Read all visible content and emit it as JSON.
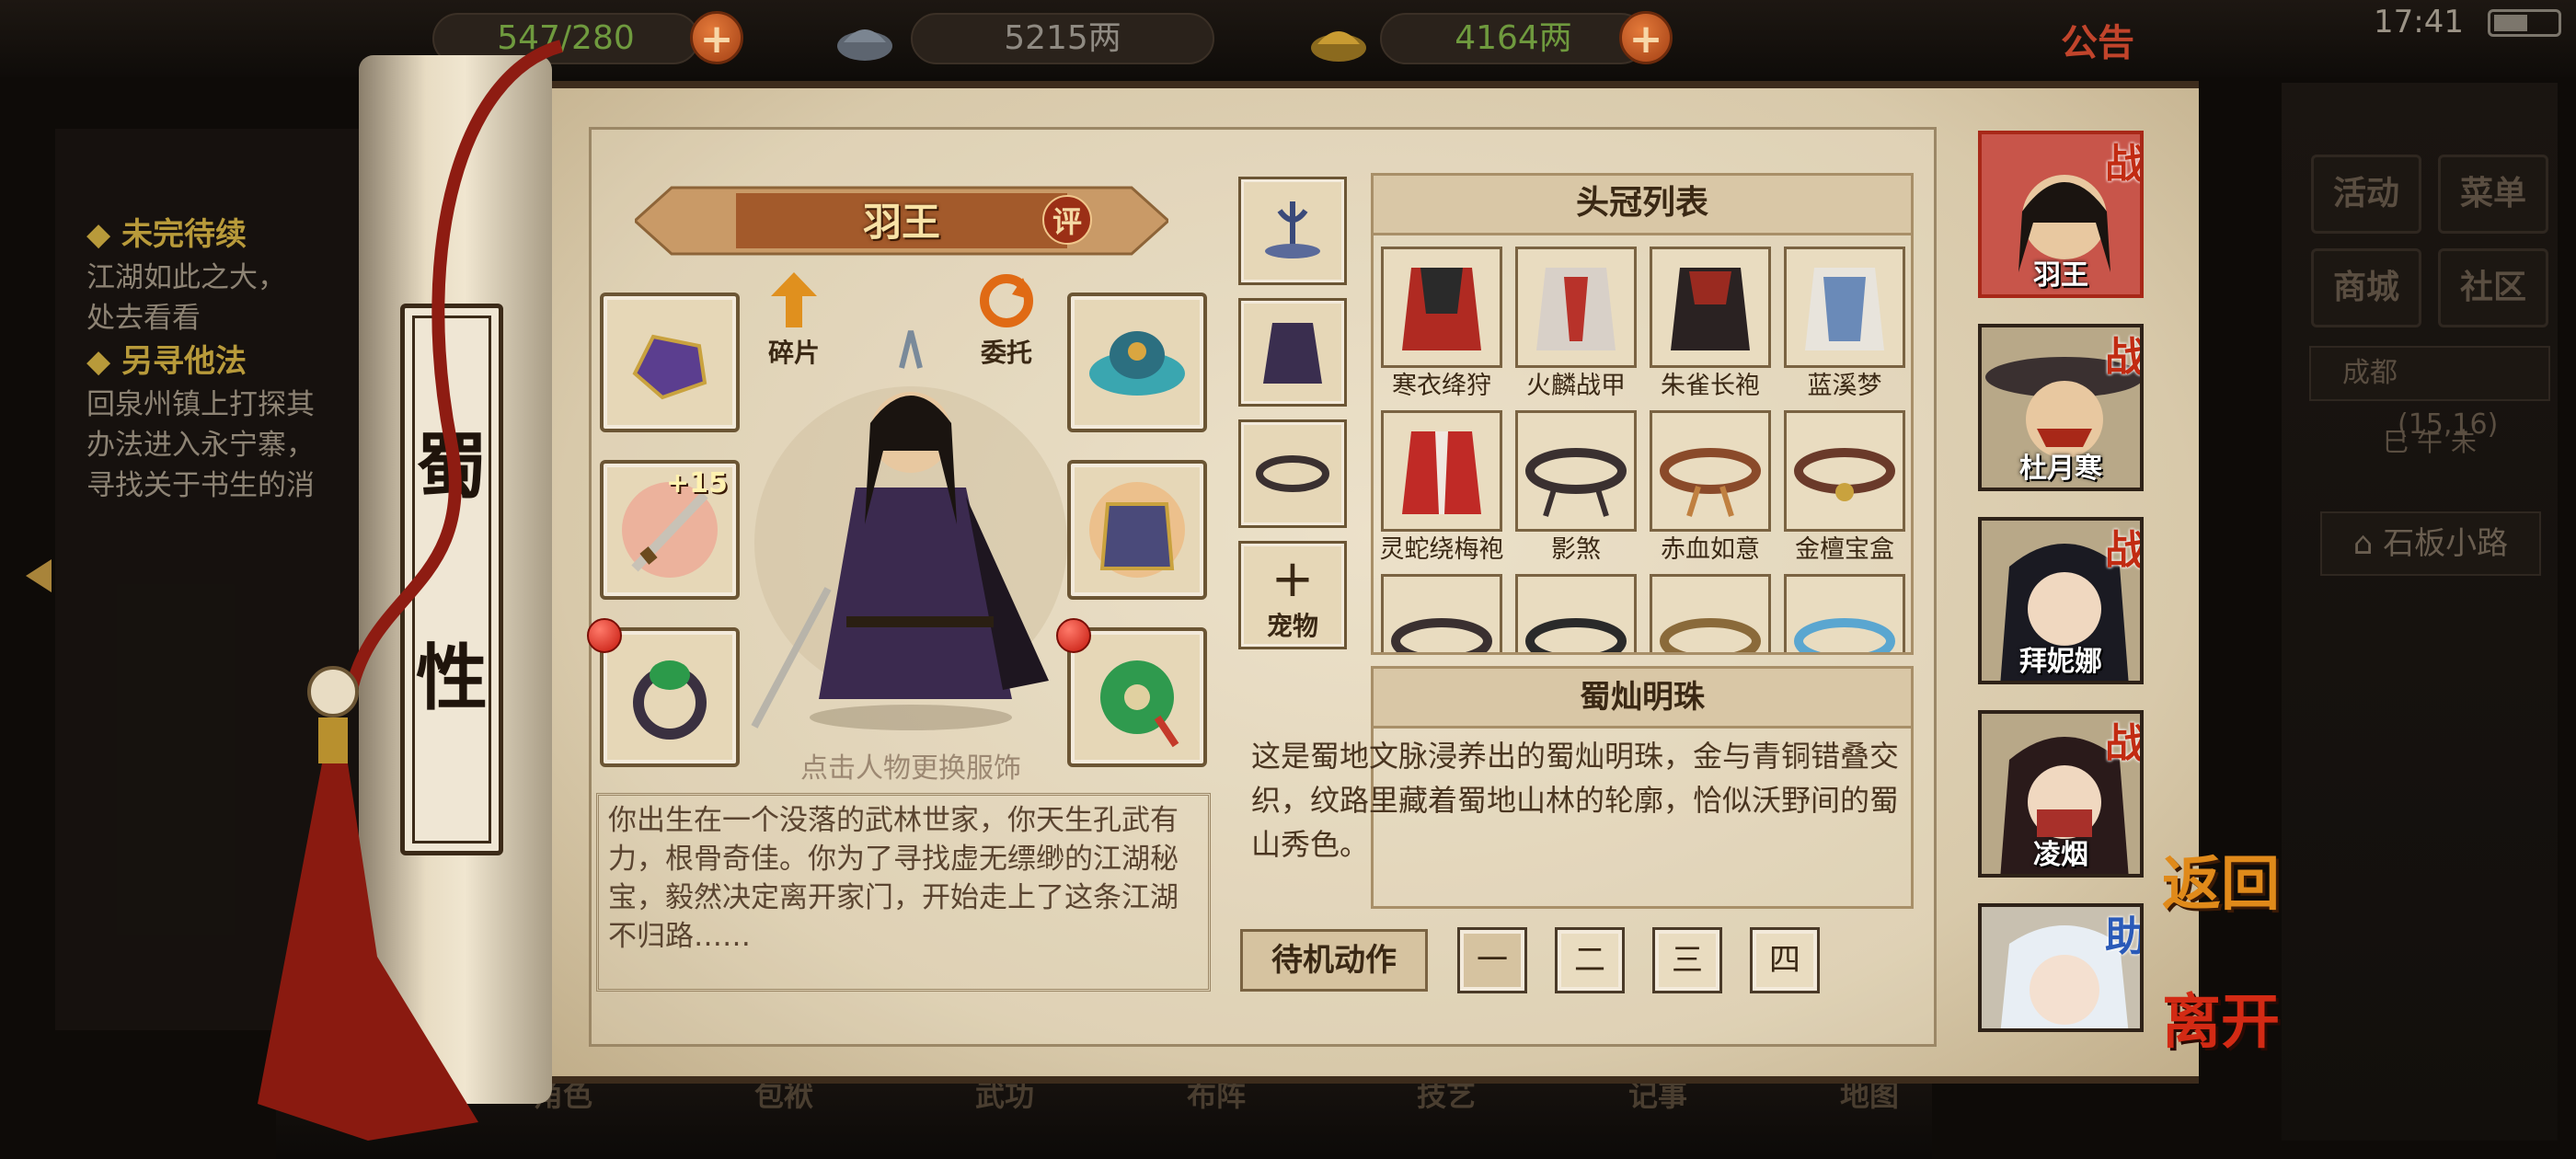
{
  "topbar": {
    "stamina": "547/280",
    "silver": "5215两",
    "gold": "4164两",
    "notice": "公告",
    "time": "17:41"
  },
  "quests": {
    "q1_title": "未完待续",
    "q1_desc": "江湖如此之大，",
    "q1_desc2": "处去看看",
    "q2_title": "另寻他法",
    "q2_desc1": "回泉州镇上打探其",
    "q2_desc2": "办法进入永宁寨，",
    "q2_desc3": "寻找关于书生的消"
  },
  "hud": {
    "activity": "活动",
    "menu": "菜单",
    "shop": "商城",
    "community": "社区",
    "location": "成都",
    "coords": "(15,16)",
    "time_row": "巳 午 未",
    "place": "石板小路"
  },
  "scroll": {
    "char1": "蜀",
    "char2": "性"
  },
  "character": {
    "name": "羽王",
    "rate_label": "评",
    "fragments_label": "碎片",
    "entrust_label": "委托",
    "weapon_level": "+15",
    "hint": "点击人物更换服饰",
    "bio": "你出生在一个没落的武林世家，你天生孔武有力，根骨奇佳。你为了寻找虚无缥缈的江湖秘宝，毅然决定离开家门，开始走上了这条江湖不归路……"
  },
  "pet_label": "宠物",
  "list": {
    "title": "头冠列表",
    "items": [
      "寒衣绛狩",
      "火麟战甲",
      "朱雀长袍",
      "蓝溪梦",
      "灵蛇绕梅袍",
      "影煞",
      "赤血如意",
      "金檀宝盒"
    ]
  },
  "selected": {
    "title": "蜀灿明珠",
    "desc": "这是蜀地文脉浸养出的蜀灿明珠，金与青铜错叠交织，纹路里藏着蜀地山林的轮廓，恰似沃野间的蜀山秀色。"
  },
  "idle": {
    "label": "待机动作",
    "opts": [
      "一",
      "二",
      "三",
      "四"
    ]
  },
  "party": [
    {
      "name": "羽王",
      "tag": "战"
    },
    {
      "name": "杜月寒",
      "tag": "战"
    },
    {
      "name": "拜妮娜",
      "tag": "战"
    },
    {
      "name": "凌烟",
      "tag": "战"
    },
    {
      "name": "",
      "tag": "助"
    }
  ],
  "buttons": {
    "back": "返回",
    "leave": "离开"
  },
  "bottom": [
    "角色",
    "包袱",
    "武功",
    "布阵",
    "技艺",
    "记事",
    "地图"
  ],
  "colors": {
    "paper": "#e2d4b6",
    "accent_red": "#c22b12",
    "gold_text": "#b89a3a"
  }
}
